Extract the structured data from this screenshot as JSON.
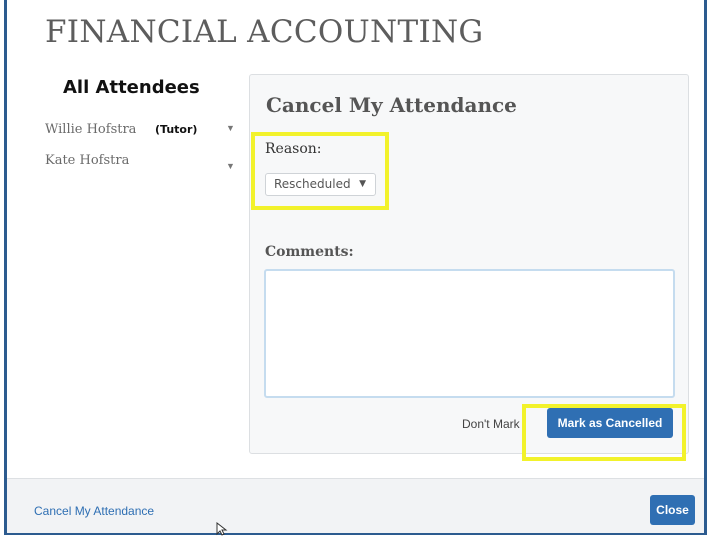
{
  "dialog": {
    "title": "FINANCIAL ACCOUNTING"
  },
  "attendees": {
    "heading": "All Attendees",
    "items": [
      {
        "name": "Willie Hofstra",
        "tag": "(Tutor)"
      },
      {
        "name": "Kate Hofstra",
        "tag": ""
      }
    ]
  },
  "cancel_panel": {
    "title": "Cancel My Attendance",
    "reason_label": "Reason:",
    "reason_value": "Rescheduled",
    "comments_label": "Comments:",
    "comments_value": "",
    "dont_mark_label": "Don't Mark",
    "mark_button_label": "Mark as Cancelled"
  },
  "footer": {
    "link_label": "Cancel My Attendance",
    "close_label": "Close"
  },
  "colors": {
    "accent": "#2f6fb3",
    "highlight": "#f2f22b",
    "frame": "#2c5b8f"
  },
  "icons": [
    "chevron-down-icon",
    "mouse-cursor-icon"
  ]
}
